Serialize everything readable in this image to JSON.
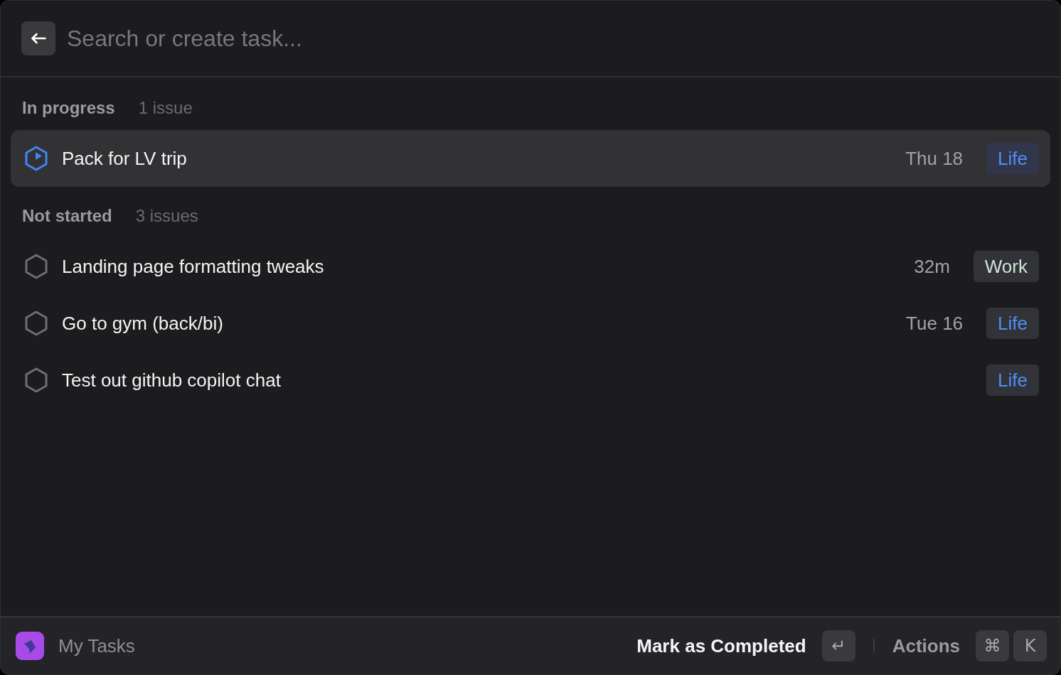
{
  "search": {
    "placeholder": "Search or create task..."
  },
  "sections": [
    {
      "title": "In progress",
      "count": "1 issue",
      "tasks": [
        {
          "title": "Pack for LV trip",
          "kind": "in_progress",
          "due": "Thu 18",
          "tag": {
            "label": "Life",
            "color": "#4f8ef7"
          },
          "selected": true
        }
      ]
    },
    {
      "title": "Not started",
      "count": "3 issues",
      "tasks": [
        {
          "title": "Landing page formatting tweaks",
          "kind": "not_started",
          "due": "32m",
          "tag": {
            "label": "Work",
            "color": "#cfe2d5"
          },
          "selected": false
        },
        {
          "title": "Go to gym (back/bi)",
          "kind": "not_started",
          "due": "Tue 16",
          "tag": {
            "label": "Life",
            "color": "#4f8ef7"
          },
          "selected": false
        },
        {
          "title": "Test out github copilot chat",
          "kind": "not_started",
          "tag": {
            "label": "Life",
            "color": "#4f8ef7"
          },
          "selected": false
        }
      ]
    }
  ],
  "footer": {
    "app_name": "My Tasks",
    "primary_action": {
      "label": "Mark as Completed",
      "keys": [
        "↵"
      ]
    },
    "secondary_action": {
      "label": "Actions",
      "keys": [
        "⌘",
        "K"
      ]
    }
  }
}
